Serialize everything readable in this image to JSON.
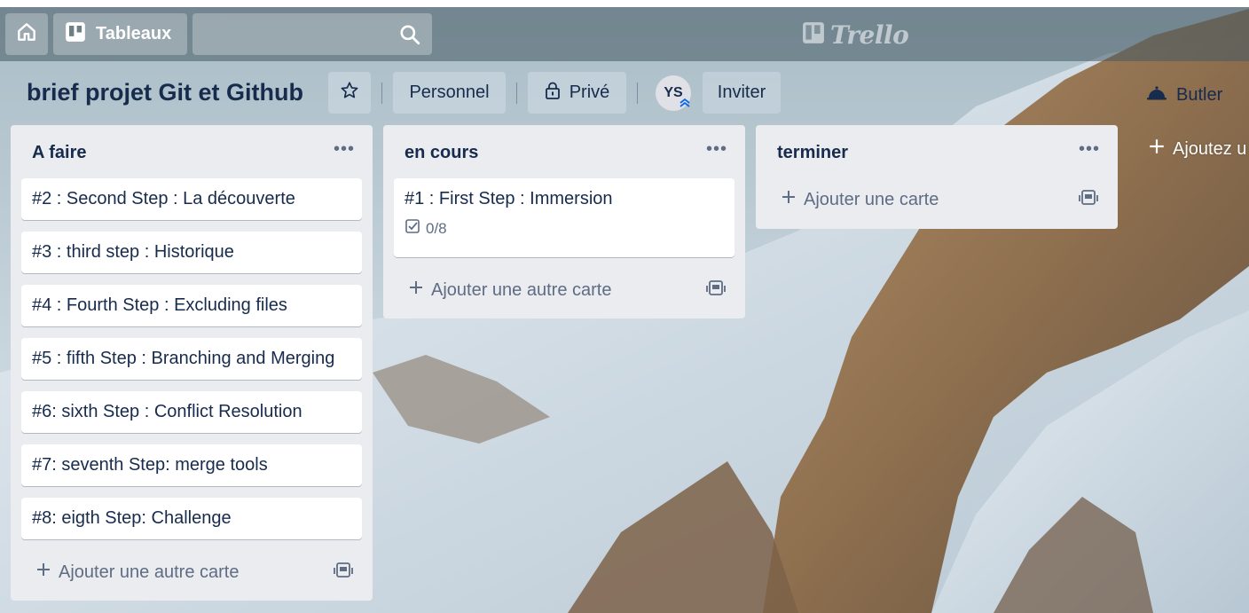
{
  "header": {
    "boards_label": "Tableaux",
    "logo_text": "Trello"
  },
  "board": {
    "title": "brief projet Git et Github",
    "team_label": "Personnel",
    "visibility_label": "Privé",
    "avatar_initials": "YS",
    "invite_label": "Inviter",
    "butler_label": "Butler"
  },
  "lists": [
    {
      "title": "A faire",
      "cards": [
        "#2 : Second Step : La découverte",
        "#3 : third step : Historique",
        "#4 : Fourth Step : Excluding files",
        "#5 : fifth Step : Branching and Merging",
        "#6: sixth Step : Conflict Resolution",
        "#7: seventh Step: merge tools",
        "#8: eigth Step: Challenge"
      ],
      "add_label": "Ajouter une autre carte"
    },
    {
      "title": "en cours",
      "cards": [
        "#1 : First Step : Immersion"
      ],
      "checklist": "0/8",
      "add_label": "Ajouter une autre carte"
    },
    {
      "title": "terminer",
      "cards": [],
      "add_label": "Ajouter une carte"
    }
  ],
  "add_list_label": "Ajoutez u",
  "icons": {
    "home": "home-icon",
    "boards": "boards-icon",
    "search": "search-icon",
    "star": "star-icon",
    "lock": "lock-icon",
    "butler": "butler-icon",
    "menu": "ellipsis-icon",
    "plus": "plus-icon",
    "template": "card-template-icon",
    "checklist": "checklist-icon"
  },
  "colors": {
    "list_bg": "#ebecf0",
    "text": "#172b4d",
    "muted": "#5e6c84"
  }
}
